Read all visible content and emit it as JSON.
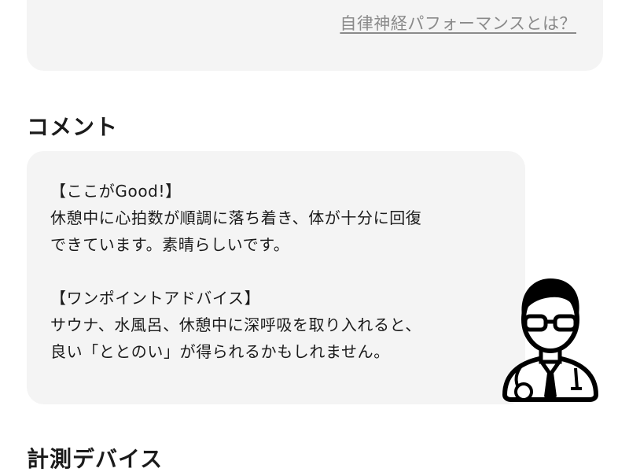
{
  "top_card": {
    "link": "自律神経パフォーマンスとは？"
  },
  "comment_section": {
    "title": "コメント",
    "lines": [
      "【ここがGood!】",
      "休憩中に心拍数が順調に落ち着き、体が十分に回復",
      "できています。素晴らしいです。",
      "【ワンポイントアドバイス】",
      "サウナ、水風呂、休憩中に深呼吸を取り入れると、",
      "良い「ととのい」が得られるかもしれません。"
    ],
    "avatar_icon": "doctor-avatar-icon"
  },
  "device_section": {
    "title": "計測デバイス"
  }
}
